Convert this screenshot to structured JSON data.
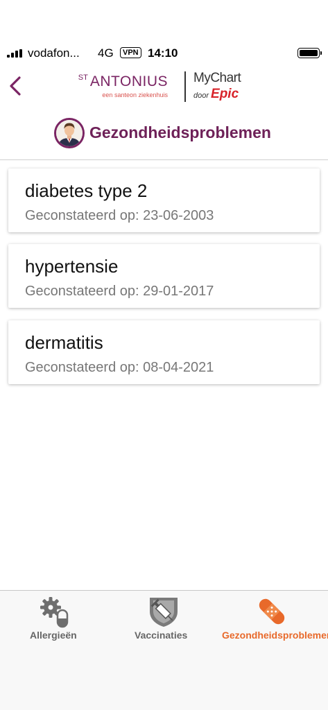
{
  "status_bar": {
    "carrier": "vodafon...",
    "network": "4G",
    "vpn": "VPN",
    "time": "14:10"
  },
  "header": {
    "back_icon": "chevron-left-icon",
    "brand": {
      "prefix": "ST",
      "name": "ANTONIUS",
      "tagline": "een santeon ziekenhuis"
    },
    "mychart": {
      "name": "MyChart",
      "by": "door",
      "vendor": "Epic"
    },
    "accent_color": "#7a2463"
  },
  "page": {
    "title": "Gezondheidsproblemen"
  },
  "problems": [
    {
      "name": "diabetes type 2",
      "date": "Geconstateerd op: 23-06-2003"
    },
    {
      "name": "hypertensie",
      "date": "Geconstateerd op: 29-01-2017"
    },
    {
      "name": "dermatitis",
      "date": "Geconstateerd op: 08-04-2021"
    }
  ],
  "tabs": [
    {
      "label": "Allergieën",
      "icon": "gear-pill-icon",
      "active": false
    },
    {
      "label": "Vaccinaties",
      "icon": "syringe-shield-icon",
      "active": false
    },
    {
      "label": "Gezondheidsproblemen",
      "icon": "bandage-icon",
      "active": true
    }
  ],
  "colors": {
    "active_tab": "#e8692a",
    "inactive_tab": "#666666"
  }
}
